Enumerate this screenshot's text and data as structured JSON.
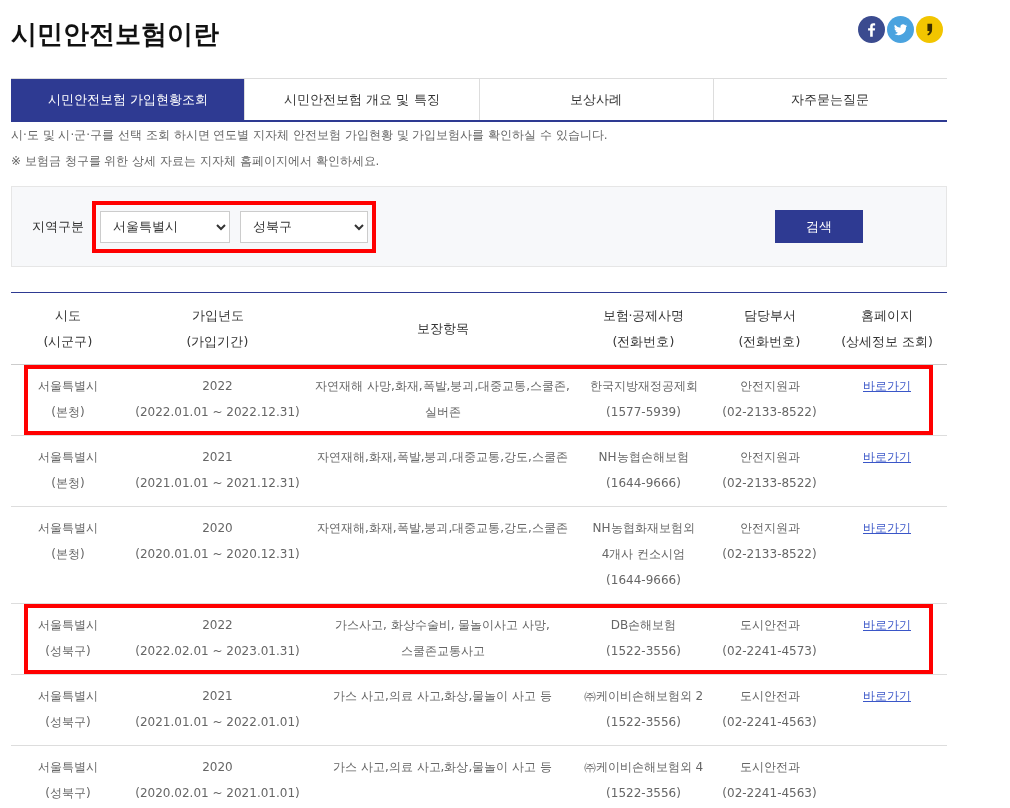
{
  "page": {
    "title": "시민안전보험이란"
  },
  "tabs": [
    {
      "label": "시민안전보험 가입현황조회",
      "selected": true
    },
    {
      "label": "시민안전보험 개요 및 특징",
      "selected": false
    },
    {
      "label": "보상사례",
      "selected": false
    },
    {
      "label": "자주묻는질문",
      "selected": false
    }
  ],
  "notes": [
    "시·도 및 시·군·구를 선택 조회 하시면 연도별 지자체 안전보험 가입현황 및 가입보험사를 확인하실 수 있습니다.",
    "※ 보험금 청구를 위한 상세 자료는 지자체 홈페이지에서 확인하세요."
  ],
  "filter": {
    "label": "지역구분",
    "province": "서울특별시",
    "district": "성북구",
    "highlighted": true,
    "button": "검색"
  },
  "table": {
    "columns": [
      "시도\n(시군구)",
      "가입년도\n(가입기간)",
      "보장항목",
      "보험·공제사명\n(전화번호)",
      "담당부서\n(전화번호)",
      "홈페이지\n(상세정보 조회)"
    ],
    "rows": [
      {
        "highlighted": true,
        "region": "서울특별시\n(본청)",
        "period": "2022\n(2022.01.01 ~ 2022.12.31)",
        "coverage": "자연재해 사망,화재,폭발,붕괴,대중교통,스쿨존,\n실버존",
        "insurer": "한국지방재정공제회\n(1577-5939)",
        "department": "안전지원과\n(02-2133-8522)",
        "link": "바로가기"
      },
      {
        "highlighted": false,
        "region": "서울특별시\n(본청)",
        "period": "2021\n(2021.01.01 ~ 2021.12.31)",
        "coverage": "자연재해,화재,폭발,붕괴,대중교통,강도,스쿨존",
        "insurer": "NH농협손해보험\n(1644-9666)",
        "department": "안전지원과\n(02-2133-8522)",
        "link": "바로가기"
      },
      {
        "highlighted": false,
        "region": "서울특별시\n(본청)",
        "period": "2020\n(2020.01.01 ~ 2020.12.31)",
        "coverage": "자연재해,화재,폭발,붕괴,대중교통,강도,스쿨존",
        "insurer": "NH농협화재보험외\n4개사 컨소시엄\n(1644-9666)",
        "department": "안전지원과\n(02-2133-8522)",
        "link": "바로가기"
      },
      {
        "highlighted": true,
        "region": "서울특별시\n(성북구)",
        "period": "2022\n(2022.02.01 ~ 2023.01.31)",
        "coverage": "가스사고, 화상수술비, 물놀이사고 사망,\n스쿨존교통사고",
        "insurer": "DB손해보험\n(1522-3556)",
        "department": "도시안전과\n(02-2241-4573)",
        "link": "바로가기"
      },
      {
        "highlighted": false,
        "region": "서울특별시\n(성북구)",
        "period": "2021\n(2021.01.01 ~ 2022.01.01)",
        "coverage": "가스 사고,의료 사고,화상,물놀이 사고 등",
        "insurer": "㈜케이비손해보험외 2\n(1522-3556)",
        "department": "도시안전과\n(02-2241-4563)",
        "link": "바로가기"
      },
      {
        "highlighted": false,
        "region": "서울특별시\n(성북구)",
        "period": "2020\n(2020.02.01 ~ 2021.01.01)",
        "coverage": "가스 사고,의료 사고,화상,물놀이 사고 등",
        "insurer": "㈜케이비손해보험외 4\n(1522-3556)",
        "department": "도시안전과\n(02-2241-4563)"
      }
    ]
  }
}
